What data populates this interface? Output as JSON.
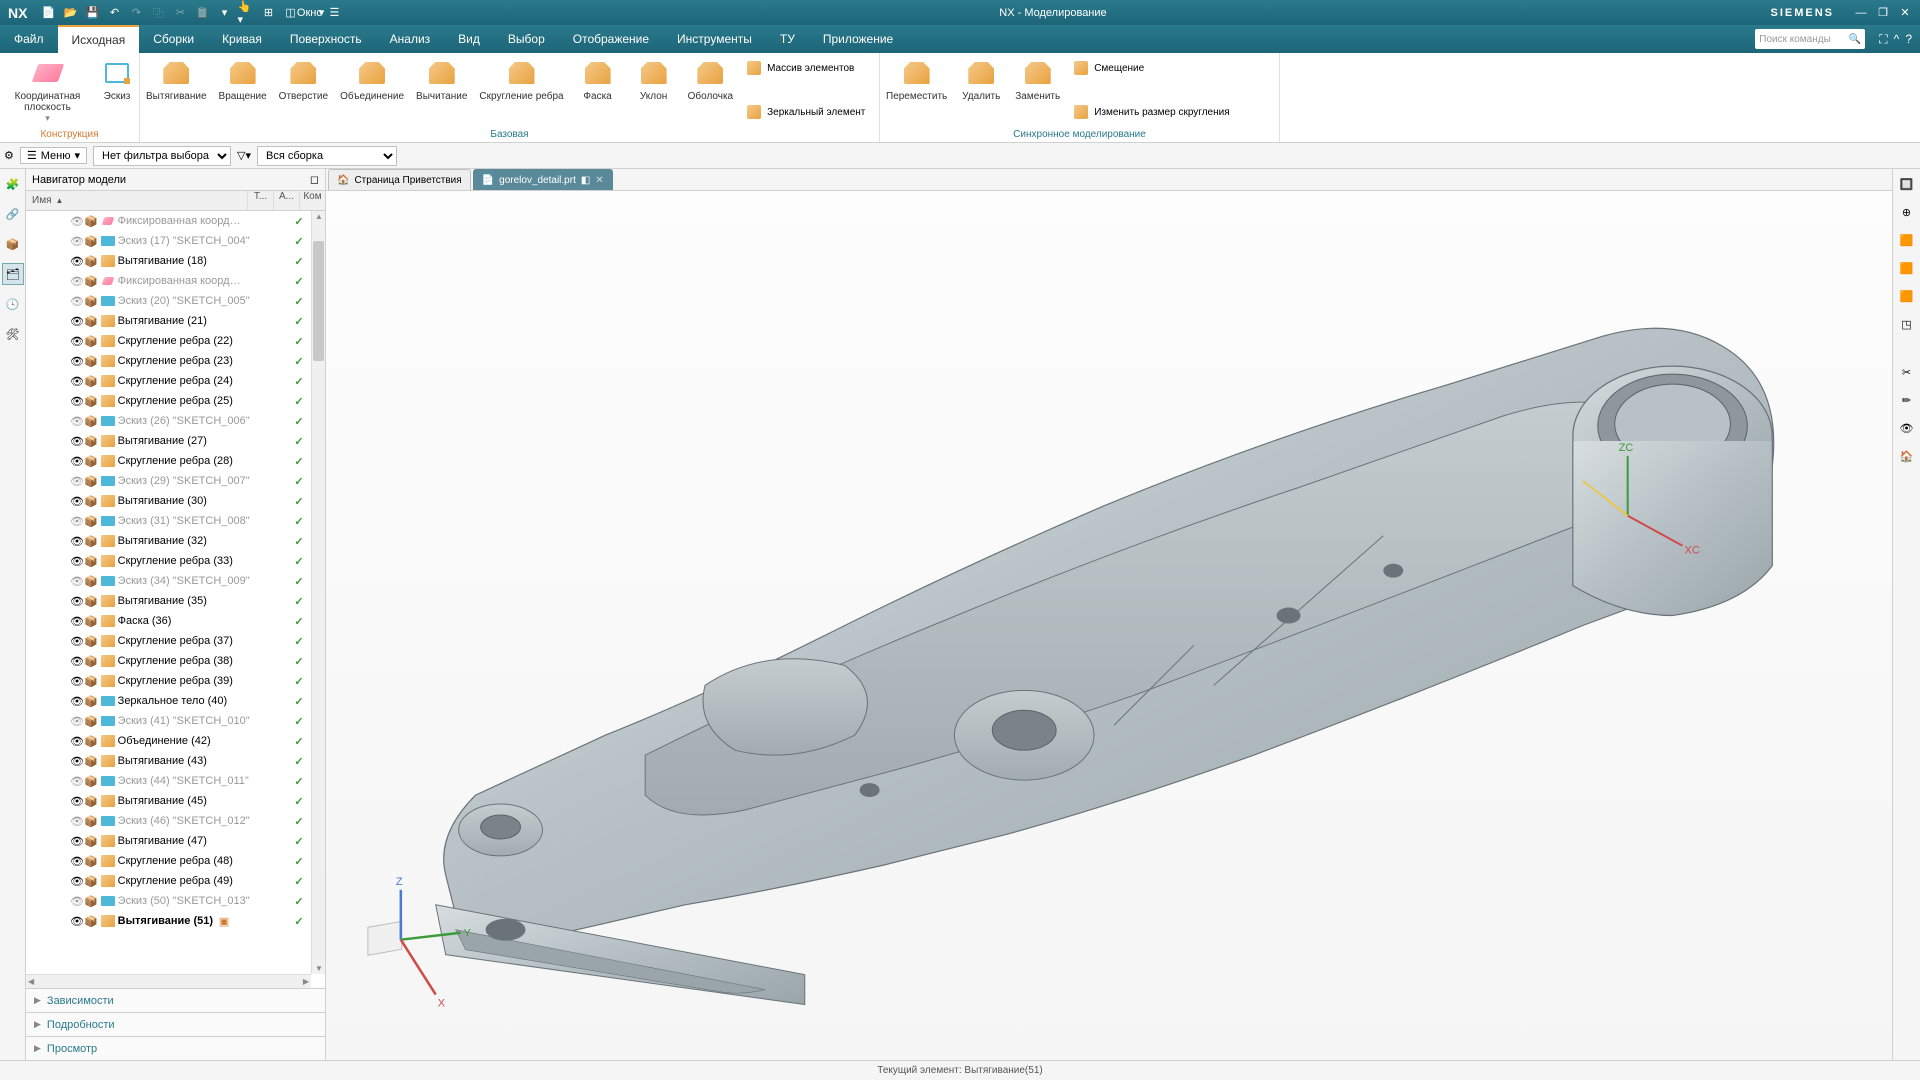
{
  "app": {
    "logo": "NX",
    "title": "NX - Моделирование",
    "brand": "SIEMENS",
    "window_menu": "Окно"
  },
  "menu": {
    "items": [
      "Файл",
      "Исходная",
      "Сборки",
      "Кривая",
      "Поверхность",
      "Анализ",
      "Вид",
      "Выбор",
      "Отображение",
      "Инструменты",
      "ТУ",
      "Приложение"
    ],
    "active": 1,
    "search_placeholder": "Поиск команды"
  },
  "ribbon": {
    "g1": {
      "label": "Конструкция",
      "btn1": "Координатная плоскость",
      "btn2": "Эскиз"
    },
    "g2": {
      "label": "Базовая",
      "btns": [
        "Вытягивание",
        "Вращение",
        "Отверстие",
        "Объединение",
        "Вычитание",
        "Скругление ребра",
        "Фаска",
        "Уклон",
        "Оболочка"
      ],
      "side": [
        "Массив элементов",
        "",
        "Зеркальный элемент"
      ]
    },
    "g3": {
      "label": "Синхронное моделирование",
      "btns": [
        "Переместить",
        "Удалить",
        "Заменить"
      ],
      "side": [
        "Смещение",
        "",
        "Изменить размер скругления"
      ]
    }
  },
  "selbar": {
    "menu": "Меню",
    "filter": "Нет фильтра выбора",
    "scope": "Вся сборка"
  },
  "nav": {
    "title": "Навигатор модели",
    "cols": [
      "Имя",
      "Т...",
      "А...",
      "Ком"
    ],
    "sections": [
      "Зависимости",
      "Подробности",
      "Просмотр"
    ],
    "items": [
      {
        "t": "Фиксированная коорд…",
        "k": "coord",
        "sk": true
      },
      {
        "t": "Эскиз (17) \"SKETCH_004\"",
        "k": "sk",
        "sk": true
      },
      {
        "t": "Вытягивание (18)",
        "k": "ext"
      },
      {
        "t": "Фиксированная коорд…",
        "k": "coord",
        "sk": true
      },
      {
        "t": "Эскиз (20) \"SKETCH_005\"",
        "k": "sk",
        "sk": true
      },
      {
        "t": "Вытягивание (21)",
        "k": "ext"
      },
      {
        "t": "Скругление ребра (22)",
        "k": "fil"
      },
      {
        "t": "Скругление ребра (23)",
        "k": "fil"
      },
      {
        "t": "Скругление ребра (24)",
        "k": "fil"
      },
      {
        "t": "Скругление ребра (25)",
        "k": "fil"
      },
      {
        "t": "Эскиз (26) \"SKETCH_006\"",
        "k": "sk",
        "sk": true
      },
      {
        "t": "Вытягивание (27)",
        "k": "ext",
        "hl": true
      },
      {
        "t": "Скругление ребра (28)",
        "k": "fil"
      },
      {
        "t": "Эскиз (29) \"SKETCH_007\"",
        "k": "sk",
        "sk": true
      },
      {
        "t": "Вытягивание (30)",
        "k": "ext"
      },
      {
        "t": "Эскиз (31) \"SKETCH_008\"",
        "k": "sk",
        "sk": true
      },
      {
        "t": "Вытягивание (32)",
        "k": "ext"
      },
      {
        "t": "Скругление ребра (33)",
        "k": "fil"
      },
      {
        "t": "Эскиз (34) \"SKETCH_009\"",
        "k": "sk",
        "sk": true
      },
      {
        "t": "Вытягивание (35)",
        "k": "ext"
      },
      {
        "t": "Фаска (36)",
        "k": "chf"
      },
      {
        "t": "Скругление ребра (37)",
        "k": "fil"
      },
      {
        "t": "Скругление ребра (38)",
        "k": "fil"
      },
      {
        "t": "Скругление ребра (39)",
        "k": "fil"
      },
      {
        "t": "Зеркальное тело (40)",
        "k": "mir"
      },
      {
        "t": "Эскиз (41) \"SKETCH_010\"",
        "k": "sk",
        "sk": true
      },
      {
        "t": "Объединение (42)",
        "k": "uni"
      },
      {
        "t": "Вытягивание (43)",
        "k": "ext"
      },
      {
        "t": "Эскиз (44) \"SKETCH_011\"",
        "k": "sk",
        "sk": true
      },
      {
        "t": "Вытягивание (45)",
        "k": "ext"
      },
      {
        "t": "Эскиз (46) \"SKETCH_012\"",
        "k": "sk",
        "sk": true
      },
      {
        "t": "Вытягивание (47)",
        "k": "ext"
      },
      {
        "t": "Скругление ребра (48)",
        "k": "fil"
      },
      {
        "t": "Скругление ребра (49)",
        "k": "fil"
      },
      {
        "t": "Эскиз (50) \"SKETCH_013\"",
        "k": "sk",
        "sk": true
      },
      {
        "t": "Вытягивание (51)",
        "k": "ext",
        "bold": true,
        "end": true
      }
    ]
  },
  "tabs": {
    "t1": "Страница Приветствия",
    "t2": "gorelov_detail.prt"
  },
  "axes": {
    "zc": "ZC",
    "xc": "XC",
    "z": "Z",
    "y": "Y",
    "x": "X"
  },
  "status": "Текущий элемент: Вытягивание(51)"
}
